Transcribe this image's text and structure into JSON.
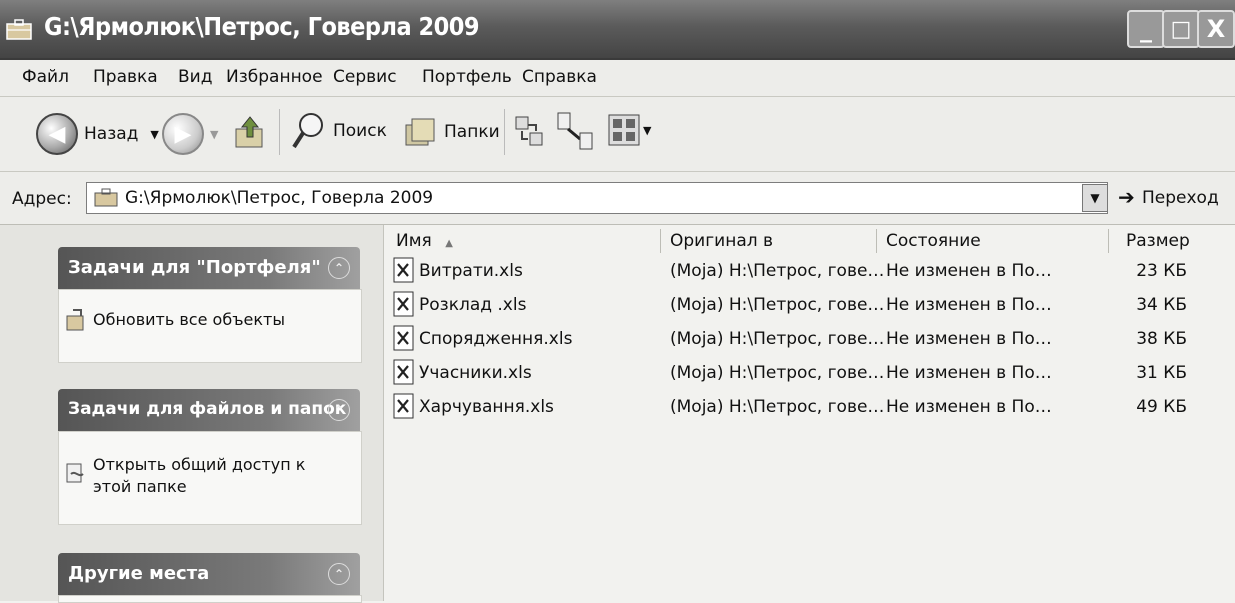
{
  "window": {
    "title": "G:\\Ярмолюк\\Петрос, Говерла 2009",
    "buttons": {
      "minimize": "_",
      "maximize": "□",
      "close": "X"
    }
  },
  "menu": [
    "Файл",
    "Правка",
    "Вид",
    "Избранное",
    "Сервис",
    "Портфель",
    "Справка"
  ],
  "toolbar": {
    "back_label": "Назад",
    "search_label": "Поиск",
    "folders_label": "Папки"
  },
  "address": {
    "label": "Адрес:",
    "value": "G:\\Ярмолюк\\Петрос, Говерла 2009",
    "go_label": "Переход"
  },
  "task_panels": [
    {
      "title": "Задачи для \"Портфеля\"",
      "items": [
        "Обновить все объекты"
      ]
    },
    {
      "title": "Задачи для файлов и папок",
      "items": [
        "Открыть общий доступ к этой папке"
      ]
    },
    {
      "title": "Другие места",
      "items": []
    }
  ],
  "file_table": {
    "columns": [
      "Имя",
      "Оригинал в",
      "Состояние",
      "Размер"
    ],
    "rows": [
      {
        "name": "Витрати.xls",
        "original": "(Moja) H:\\Петрос, гове…",
        "status": "Не изменен в По…",
        "size": "23 КБ"
      },
      {
        "name": "Розклад .xls",
        "original": "(Moja) H:\\Петрос, гове…",
        "status": "Не изменен в По…",
        "size": "34 КБ"
      },
      {
        "name": "Спорядження.xls",
        "original": "(Moja) H:\\Петрос, гове…",
        "status": "Не изменен в По…",
        "size": "38 КБ"
      },
      {
        "name": "Учасники.xls",
        "original": "(Moja) H:\\Петрос, гове…",
        "status": "Не изменен в По…",
        "size": "31 КБ"
      },
      {
        "name": "Харчування.xls",
        "original": "(Moja) H:\\Петрос, гове…",
        "status": "Не изменен в По…",
        "size": "49 КБ"
      }
    ]
  },
  "icons": {
    "title": "briefcase-icon",
    "back": "back-arrow-icon",
    "forward": "forward-arrow-icon",
    "up": "folder-up-icon",
    "search": "search-icon",
    "folders": "folders-icon",
    "file": "excel-file-icon"
  }
}
